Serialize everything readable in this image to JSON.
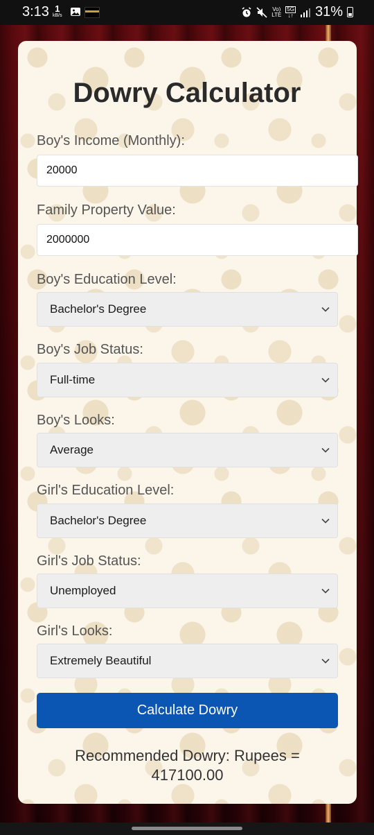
{
  "status_bar": {
    "time": "3:13",
    "net_speed_value": "1",
    "net_speed_unit": "kB/s",
    "network_top": "Vo)",
    "network_bottom": "LTE",
    "gen_top": "5G",
    "gen_bottom": "↓↑",
    "battery": "31%"
  },
  "page": {
    "title": "Dowry Calculator"
  },
  "form": {
    "boys_income": {
      "label": "Boy's Income (Monthly):",
      "value": "20000"
    },
    "family_property": {
      "label": "Family Property Value:",
      "value": "2000000"
    },
    "boys_education": {
      "label": "Boy's Education Level:",
      "selected": "Bachelor's Degree"
    },
    "boys_job": {
      "label": "Boy's Job Status:",
      "selected": "Full-time"
    },
    "boys_looks": {
      "label": "Boy's Looks:",
      "selected": "Average"
    },
    "girls_education": {
      "label": "Girl's Education Level:",
      "selected": "Bachelor's Degree"
    },
    "girls_job": {
      "label": "Girl's Job Status:",
      "selected": "Unemployed"
    },
    "girls_looks": {
      "label": "Girl's Looks:",
      "selected": "Extremely Beautiful"
    },
    "calculate_label": "Calculate Dowry"
  },
  "result": {
    "line1": "Recommended Dowry: Rupees =",
    "line2": "417100.00"
  },
  "colors": {
    "button": "#0b55b3",
    "card": "#fbf5ea",
    "curtain": "#4a0609"
  }
}
